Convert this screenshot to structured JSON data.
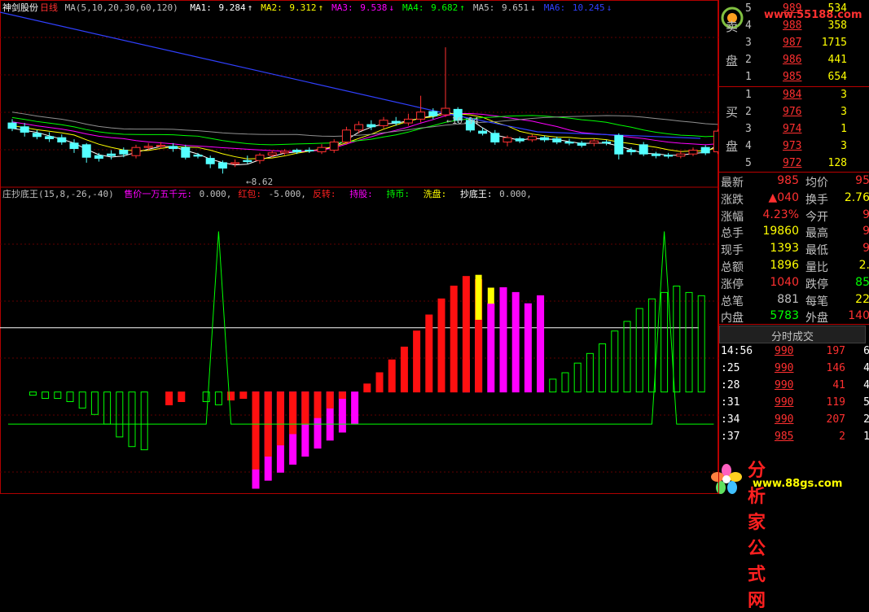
{
  "main_header": {
    "name": "神剑股份",
    "period": "日线",
    "ma_label": "MA(5,10,20,30,60,120)",
    "ma": [
      {
        "label": "MA1:",
        "value": "9.284",
        "arrow": "↑",
        "color": "#ffffff"
      },
      {
        "label": "MA2:",
        "value": "9.312",
        "arrow": "↑",
        "color": "#ffff00"
      },
      {
        "label": "MA3:",
        "value": "9.538",
        "arrow": "↓",
        "color": "#ff00ff"
      },
      {
        "label": "MA4:",
        "value": "9.682",
        "arrow": "↑",
        "color": "#00ff00"
      },
      {
        "label": "MA5:",
        "value": "9.651",
        "arrow": "↓",
        "color": "#c0c0c0"
      },
      {
        "label": "MA6:",
        "value": "10.245",
        "arrow": "↓",
        "color": "#3040ff"
      }
    ]
  },
  "price_annotations": {
    "high": "10.94",
    "low": "8.62"
  },
  "indicator_header": {
    "name": "庄抄底王(15,8,-26,-40)",
    "items": [
      {
        "label": "售价一万五千元:",
        "value": "0.000,",
        "color": "#ff00ff"
      },
      {
        "label": "红包:",
        "value": "-5.000,",
        "color": "#ff2020"
      },
      {
        "label": "反转:",
        "value": "",
        "color": "#ff2020"
      },
      {
        "label": "持股:",
        "value": "",
        "color": "#ff00ff"
      },
      {
        "label": "持币:",
        "value": "",
        "color": "#00ff00"
      },
      {
        "label": "洗盘:",
        "value": "",
        "color": "#ffff00"
      },
      {
        "label": "抄底王:",
        "value": "0.000,",
        "color": "#ffffff"
      }
    ]
  },
  "order_book": {
    "sell_label_top": "卖",
    "sell_label_bottom": "盘",
    "buy_label_top": "买",
    "buy_label_bottom": "盘",
    "sell": [
      {
        "level": "5",
        "price": "989",
        "volume": "534"
      },
      {
        "level": "4",
        "price": "988",
        "volume": "358"
      },
      {
        "level": "3",
        "price": "987",
        "volume": "1715"
      },
      {
        "level": "2",
        "price": "986",
        "volume": "441"
      },
      {
        "level": "1",
        "price": "985",
        "volume": "654"
      }
    ],
    "buy": [
      {
        "level": "1",
        "price": "984",
        "volume": "3"
      },
      {
        "level": "2",
        "price": "976",
        "volume": "3"
      },
      {
        "level": "3",
        "price": "974",
        "volume": "1"
      },
      {
        "level": "4",
        "price": "973",
        "volume": "3"
      },
      {
        "level": "5",
        "price": "972",
        "volume": "128"
      }
    ]
  },
  "stats": [
    {
      "l1": "最新",
      "v1": "985",
      "c1": "#ff3030",
      "l2": "均价",
      "v2": "95",
      "c2": "#ff3030"
    },
    {
      "l1": "涨跌",
      "v1": "▲040",
      "c1": "#ff3030",
      "l2": "换手",
      "v2": "2.76",
      "c2": "#ffff00"
    },
    {
      "l1": "涨幅",
      "v1": "4.23%",
      "c1": "#ff3030",
      "l2": "今开",
      "v2": "9",
      "c2": "#ff3030"
    },
    {
      "l1": "总手",
      "v1": "19860",
      "c1": "#ffff00",
      "l2": "最高",
      "v2": "9",
      "c2": "#ff3030"
    },
    {
      "l1": "现手",
      "v1": "1393",
      "c1": "#ffff00",
      "l2": "最低",
      "v2": "9",
      "c2": "#ff3030"
    },
    {
      "l1": "总额",
      "v1": "1896",
      "c1": "#ffff00",
      "l2": "量比",
      "v2": "2.",
      "c2": "#ffff00"
    },
    {
      "l1": "涨停",
      "v1": "1040",
      "c1": "#ff3030",
      "l2": "跌停",
      "v2": "85",
      "c2": "#00ff00"
    },
    {
      "l1": "总笔",
      "v1": "881",
      "c1": "#c0c0c0",
      "l2": "每笔",
      "v2": "22",
      "c2": "#ffff00"
    },
    {
      "l1": "内盘",
      "v1": "5783",
      "c1": "#00ff00",
      "l2": "外盘",
      "v2": "140",
      "c2": "#ff3030"
    }
  ],
  "trades_header": "分时成交",
  "trades": [
    {
      "time": "14:56",
      "price": "990",
      "vol": "197",
      "extra": "6"
    },
    {
      "time": ":25",
      "price": "990",
      "vol": "146",
      "extra": "4"
    },
    {
      "time": ":28",
      "price": "990",
      "vol": "41",
      "extra": "4"
    },
    {
      "time": ":31",
      "price": "990",
      "vol": "119",
      "extra": "5"
    },
    {
      "time": ":34",
      "price": "990",
      "vol": "207",
      "extra": "2"
    },
    {
      "time": ":37",
      "price": "985",
      "vol": "2",
      "extra": "1"
    }
  ],
  "watermarks": {
    "top": "www.55188.com",
    "bottom_cn": "分析家公式网",
    "bottom_url": "www.88gs.com"
  },
  "chart_data": [
    {
      "type": "candlestick",
      "title": "神剑股份 日线",
      "annotations": {
        "high": 10.94,
        "low": 8.62
      },
      "ylim": [
        8.4,
        11.6
      ],
      "candles": [
        {
          "o": 9.55,
          "c": 9.45,
          "h": 9.62,
          "l": 9.4
        },
        {
          "o": 9.48,
          "c": 9.38,
          "h": 9.55,
          "l": 9.3
        },
        {
          "o": 9.36,
          "c": 9.3,
          "h": 9.42,
          "l": 9.25
        },
        {
          "o": 9.3,
          "c": 9.26,
          "h": 9.38,
          "l": 9.2
        },
        {
          "o": 9.28,
          "c": 9.2,
          "h": 9.34,
          "l": 9.15
        },
        {
          "o": 9.18,
          "c": 9.08,
          "h": 9.25,
          "l": 9.0
        },
        {
          "o": 9.15,
          "c": 8.92,
          "h": 9.18,
          "l": 8.82
        },
        {
          "o": 8.95,
          "c": 8.9,
          "h": 9.0,
          "l": 8.84
        },
        {
          "o": 8.98,
          "c": 8.95,
          "h": 9.05,
          "l": 8.88
        },
        {
          "o": 9.05,
          "c": 8.98,
          "h": 9.1,
          "l": 8.92
        },
        {
          "o": 8.95,
          "c": 9.1,
          "h": 9.15,
          "l": 8.9
        },
        {
          "o": 9.1,
          "c": 9.12,
          "h": 9.18,
          "l": 9.05
        },
        {
          "o": 9.12,
          "c": 9.14,
          "h": 9.2,
          "l": 9.08
        },
        {
          "o": 9.12,
          "c": 9.08,
          "h": 9.18,
          "l": 9.02
        },
        {
          "o": 9.1,
          "c": 8.92,
          "h": 9.15,
          "l": 8.88
        },
        {
          "o": 8.96,
          "c": 8.94,
          "h": 9.0,
          "l": 8.9
        },
        {
          "o": 8.9,
          "c": 8.8,
          "h": 8.95,
          "l": 8.72
        },
        {
          "o": 8.82,
          "c": 8.72,
          "h": 8.86,
          "l": 8.62
        },
        {
          "o": 8.8,
          "c": 8.82,
          "h": 8.88,
          "l": 8.74
        },
        {
          "o": 8.86,
          "c": 8.84,
          "h": 8.95,
          "l": 8.8
        },
        {
          "o": 8.86,
          "c": 8.96,
          "h": 9.0,
          "l": 8.8
        },
        {
          "o": 8.96,
          "c": 9.0,
          "h": 9.05,
          "l": 8.92
        },
        {
          "o": 9.0,
          "c": 9.03,
          "h": 9.07,
          "l": 8.96
        },
        {
          "o": 9.05,
          "c": 9.02,
          "h": 9.08,
          "l": 8.98
        },
        {
          "o": 9.05,
          "c": 9.04,
          "h": 9.1,
          "l": 9.0
        },
        {
          "o": 9.02,
          "c": 9.1,
          "h": 9.16,
          "l": 8.98
        },
        {
          "o": 9.05,
          "c": 9.2,
          "h": 9.25,
          "l": 9.0
        },
        {
          "o": 9.2,
          "c": 9.42,
          "h": 9.48,
          "l": 9.15
        },
        {
          "o": 9.42,
          "c": 9.52,
          "h": 9.58,
          "l": 9.36
        },
        {
          "o": 9.52,
          "c": 9.48,
          "h": 9.6,
          "l": 9.42
        },
        {
          "o": 9.5,
          "c": 9.6,
          "h": 9.66,
          "l": 9.45
        },
        {
          "o": 9.58,
          "c": 9.55,
          "h": 9.66,
          "l": 9.5
        },
        {
          "o": 9.55,
          "c": 9.62,
          "h": 9.72,
          "l": 9.5
        },
        {
          "o": 9.62,
          "c": 9.75,
          "h": 10.05,
          "l": 9.56
        },
        {
          "o": 9.76,
          "c": 9.68,
          "h": 9.82,
          "l": 9.62
        },
        {
          "o": 9.7,
          "c": 9.82,
          "h": 10.94,
          "l": 9.66
        },
        {
          "o": 9.8,
          "c": 9.6,
          "h": 9.84,
          "l": 9.55
        },
        {
          "o": 9.6,
          "c": 9.42,
          "h": 9.65,
          "l": 9.38
        },
        {
          "o": 9.4,
          "c": 9.36,
          "h": 9.46,
          "l": 9.32
        },
        {
          "o": 9.36,
          "c": 9.2,
          "h": 9.42,
          "l": 9.15
        },
        {
          "o": 9.2,
          "c": 9.28,
          "h": 9.32,
          "l": 9.12
        },
        {
          "o": 9.26,
          "c": 9.22,
          "h": 9.3,
          "l": 9.18
        },
        {
          "o": 9.24,
          "c": 9.3,
          "h": 9.34,
          "l": 9.2
        },
        {
          "o": 9.28,
          "c": 9.24,
          "h": 9.32,
          "l": 9.2
        },
        {
          "o": 9.26,
          "c": 9.2,
          "h": 9.3,
          "l": 9.16
        },
        {
          "o": 9.2,
          "c": 9.18,
          "h": 9.26,
          "l": 9.14
        },
        {
          "o": 9.18,
          "c": 9.14,
          "h": 9.22,
          "l": 9.1
        },
        {
          "o": 9.18,
          "c": 9.22,
          "h": 9.26,
          "l": 9.12
        },
        {
          "o": 9.2,
          "c": 9.18,
          "h": 9.24,
          "l": 9.14
        },
        {
          "o": 9.32,
          "c": 8.98,
          "h": 9.36,
          "l": 8.88
        },
        {
          "o": 9.05,
          "c": 9.02,
          "h": 9.1,
          "l": 8.96
        },
        {
          "o": 9.15,
          "c": 8.98,
          "h": 9.2,
          "l": 8.94
        },
        {
          "o": 8.98,
          "c": 8.95,
          "h": 9.02,
          "l": 8.9
        },
        {
          "o": 8.96,
          "c": 8.94,
          "h": 9.0,
          "l": 8.9
        },
        {
          "o": 8.94,
          "c": 8.98,
          "h": 9.04,
          "l": 8.9
        },
        {
          "o": 8.98,
          "c": 9.05,
          "h": 9.1,
          "l": 8.94
        },
        {
          "o": 9.1,
          "c": 9.0,
          "h": 9.14,
          "l": 8.96
        },
        {
          "o": 9.02,
          "c": 9.4,
          "h": 9.44,
          "l": 8.98
        }
      ]
    },
    {
      "type": "bar",
      "title": "庄抄底王(15,8,-26,-40)",
      "zero": 0,
      "ylim": [
        -60,
        120
      ],
      "magenta_bars": [
        0,
        0,
        0,
        0,
        0,
        0,
        0,
        0,
        0,
        0,
        0,
        0,
        0,
        0,
        0,
        0,
        0,
        0,
        0,
        0,
        -60,
        -55,
        -50,
        -45,
        -40,
        -35,
        -30,
        -25,
        -20,
        0,
        0,
        0,
        0,
        0,
        0,
        0,
        0,
        20,
        45,
        55,
        65,
        62,
        55,
        60,
        0,
        0,
        0,
        0,
        0,
        0,
        0,
        0,
        0,
        0,
        0,
        0,
        0,
        0
      ],
      "red_bars": [
        0,
        0,
        0,
        0,
        0,
        0,
        0,
        0,
        0,
        0,
        0,
        0,
        0,
        -8,
        -6,
        0,
        0,
        0,
        -5,
        -4,
        -48,
        -40,
        -33,
        -26,
        -20,
        -16,
        -10,
        -4,
        0,
        5,
        12,
        20,
        28,
        38,
        48,
        58,
        66,
        72,
        70,
        0,
        0,
        0,
        0,
        0,
        0,
        0,
        0,
        0,
        0,
        0,
        0,
        0,
        0,
        0,
        0,
        0,
        0,
        0
      ],
      "yellow_bars": [
        0,
        0,
        0,
        0,
        0,
        0,
        0,
        0,
        0,
        0,
        0,
        0,
        0,
        0,
        0,
        0,
        0,
        0,
        0,
        0,
        0,
        0,
        0,
        0,
        0,
        0,
        0,
        0,
        0,
        0,
        0,
        0,
        0,
        0,
        0,
        0,
        0,
        0,
        28,
        10,
        0,
        0,
        0,
        0,
        0,
        0,
        0,
        0,
        0,
        0,
        0,
        0,
        0,
        0,
        0,
        0,
        0,
        0
      ],
      "green_hollow_bars": [
        0,
        0,
        -2,
        -4,
        -4,
        -6,
        -10,
        -14,
        -20,
        -28,
        -34,
        -36,
        0,
        0,
        0,
        0,
        -6,
        -8,
        0,
        0,
        0,
        0,
        0,
        0,
        0,
        0,
        0,
        0,
        0,
        0,
        0,
        0,
        0,
        0,
        0,
        0,
        0,
        0,
        0,
        0,
        0,
        0,
        0,
        0,
        8,
        12,
        18,
        24,
        30,
        38,
        44,
        52,
        58,
        62,
        66,
        62,
        60,
        0
      ],
      "line_values": [
        -20,
        -20,
        -20,
        -20,
        -20,
        -20,
        -20,
        -20,
        -20,
        -20,
        -20,
        -20,
        -20,
        -20,
        -20,
        -20,
        -20,
        100,
        -20,
        -20,
        -20,
        -20,
        -20,
        -20,
        -20,
        -20,
        -20,
        -20,
        -20,
        -20,
        -20,
        -20,
        -20,
        -20,
        -20,
        -20,
        -20,
        -20,
        -20,
        -20,
        -20,
        -20,
        -20,
        -20,
        -20,
        -20,
        -20,
        -20,
        -20,
        -20,
        -20,
        -20,
        -20,
        100,
        -20,
        -20,
        -20,
        -20
      ],
      "reference_line": 40
    }
  ],
  "colors": {
    "up": "#ff3030",
    "down": "#54ffff",
    "axis": "#b00000",
    "ma_blue": "#3040ff"
  }
}
